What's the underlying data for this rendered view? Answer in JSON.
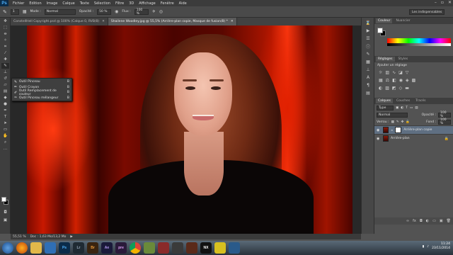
{
  "app": {
    "logo": "Ps"
  },
  "menubar": {
    "items": [
      "Fichier",
      "Edition",
      "Image",
      "Calque",
      "Texte",
      "Sélection",
      "Filtre",
      "3D",
      "Affichage",
      "Fenêtre",
      "Aide"
    ]
  },
  "options_bar": {
    "brush_size": "1",
    "mode_label": "Mode :",
    "mode_value": "Normal",
    "opacity_label": "Opacité :",
    "opacity_value": "50 %",
    "flow_label": "Flux :",
    "flow_value": "100 %",
    "workspace": "Les indispensables"
  },
  "tabs": [
    {
      "label": "ConstellHell Copyright.psd @ 100% (Calque 0, RVB/8)",
      "active": false
    },
    {
      "label": "Shailene Woodley.jpg @ 55,5% (Arrière-plan copie, Masque de fusion/8) *",
      "active": true
    }
  ],
  "tool_flyout": {
    "items": [
      {
        "icon": "brush-icon",
        "label": "Outil Pinceau",
        "key": "B"
      },
      {
        "icon": "pencil-icon",
        "label": "Outil Crayon",
        "key": "B"
      },
      {
        "icon": "color-replacement-icon",
        "label": "Outil Remplacement de couleur",
        "key": "B"
      },
      {
        "icon": "mixer-brush-icon",
        "label": "Outil Pinceau mélangeur",
        "key": "B"
      }
    ]
  },
  "color_panel": {
    "tabs": [
      "Couleur",
      "Nuancier"
    ],
    "fg_color": "#ffffff",
    "bg_color": "#000000"
  },
  "adjustments_panel": {
    "tabs": [
      "Réglages",
      "Styles"
    ],
    "title": "Ajouter un réglage"
  },
  "layers_panel": {
    "tabs": [
      "Calques",
      "Couches",
      "Tracés"
    ],
    "filter": "Type",
    "blend_mode": "Normal",
    "opacity_label": "Opacité :",
    "opacity_value": "100 %",
    "lock_label": "Verrou :",
    "fill_label": "Fond :",
    "fill_value": "100 %",
    "layers": [
      {
        "name": "Arrière-plan copie",
        "selected": true,
        "has_mask": true,
        "locked": false
      },
      {
        "name": "Arrière-plan",
        "selected": false,
        "has_mask": false,
        "locked": true
      }
    ]
  },
  "status_bar": {
    "zoom": "55,51 %",
    "doc": "Doc : 1,63 Mo/13,2 Mo"
  },
  "taskbar": {
    "apps": [
      {
        "icon": "windows-start-icon",
        "label": ""
      },
      {
        "icon": "firefox-icon",
        "label": ""
      },
      {
        "icon": "folder-icon",
        "label": ""
      },
      {
        "icon": "media-player-icon",
        "label": ""
      },
      {
        "icon": "photoshop-icon",
        "label": "Ps"
      },
      {
        "icon": "lightroom-icon",
        "label": "Lr"
      },
      {
        "icon": "bridge-icon",
        "label": "Br"
      },
      {
        "icon": "after-effects-icon",
        "label": "Ae"
      },
      {
        "icon": "premiere-icon",
        "label": "pre"
      },
      {
        "icon": "chrome-icon",
        "label": ""
      },
      {
        "icon": "app-icon",
        "label": ""
      },
      {
        "icon": "app-icon",
        "label": ""
      },
      {
        "icon": "app-icon",
        "label": ""
      },
      {
        "icon": "app-icon",
        "label": ""
      },
      {
        "icon": "nero-icon",
        "label": "NX"
      },
      {
        "icon": "app-icon",
        "label": ""
      },
      {
        "icon": "app-icon",
        "label": ""
      }
    ],
    "time": "11:24",
    "date": "23/11/2014"
  }
}
